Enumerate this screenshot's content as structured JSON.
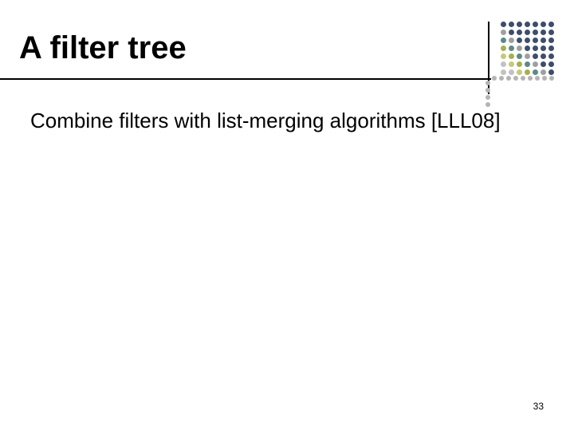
{
  "title": "A filter tree",
  "body": "Combine filters with list-merging algorithms [LLL08]",
  "page_number": "33",
  "decoration": {
    "grid_colors": {
      "dark": "#3d4d6b",
      "gray": "#a0a0a0",
      "teal": "#5b8a8a",
      "olive": "#a8b04a",
      "light_olive": "#c8c878",
      "light_gray": "#c2c2c2"
    }
  }
}
